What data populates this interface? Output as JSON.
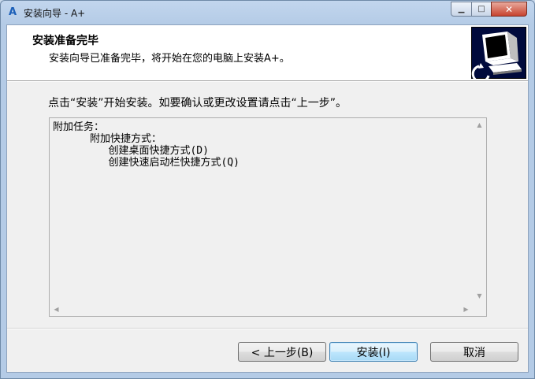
{
  "window": {
    "title": "安装向导 - A+",
    "app_icon_glyph": "A",
    "minimize_glyph": "▁",
    "maximize_glyph": "□",
    "close_glyph": "✕"
  },
  "header": {
    "title": "安装准备完毕",
    "subtitle": "安装向导已准备完毕，将开始在您的电脑上安装A+。",
    "image_icon": "computer-install-icon"
  },
  "instruction": "点击“安装”开始安装。如要确认或更改设置请点击“上一步”。",
  "memo": {
    "lines": [
      "附加任务：",
      "      附加快捷方式：",
      "         创建桌面快捷方式(D)",
      "         创建快速启动栏快捷方式(Q)"
    ],
    "scroll_up_glyph": "▲",
    "scroll_down_glyph": "▼",
    "scroll_left_glyph": "◀",
    "scroll_right_glyph": "▶"
  },
  "buttons": {
    "back_label": "< 上一步(B)",
    "install_label": "安装(I)",
    "cancel_label": "取消"
  }
}
